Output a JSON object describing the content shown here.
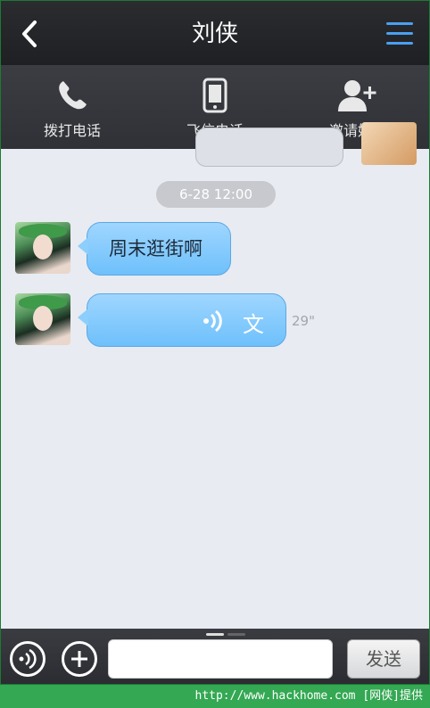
{
  "header": {
    "title": "刘侠"
  },
  "actions": [
    {
      "label": "拨打电话",
      "icon": "phone-icon"
    },
    {
      "label": "飞信电话",
      "icon": "mobile-icon"
    },
    {
      "label": "邀请好友",
      "icon": "add-friend-icon"
    }
  ],
  "chat": {
    "timestamp": "6-28  12:00",
    "messages": [
      {
        "type": "text",
        "text": "周末逛街啊"
      },
      {
        "type": "voice",
        "convert_label": "文",
        "duration": "29\""
      }
    ]
  },
  "inputbar": {
    "send_label": "发送"
  },
  "watermark": "http://www.hackhome.com [网侠]提供",
  "colors": {
    "accent": "#4aa0f0",
    "bubble": "#8ccffd"
  }
}
